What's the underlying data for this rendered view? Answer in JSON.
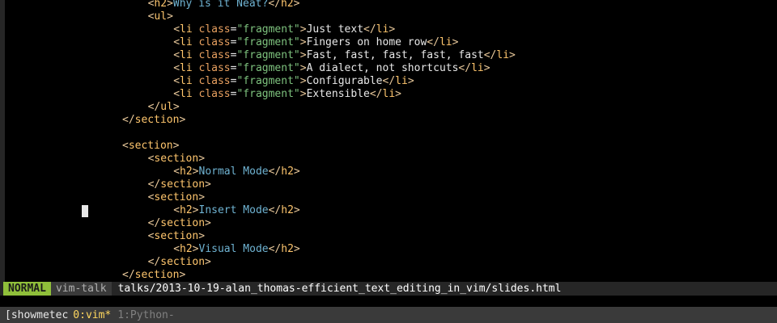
{
  "editor": {
    "lines": [
      {
        "indent": 24,
        "segments": [
          {
            "t": "<",
            "c": "bracket"
          },
          {
            "t": "h2",
            "c": "tag"
          },
          {
            "t": ">",
            "c": "bracket"
          },
          {
            "t": "Why is it Neat?",
            "c": "h2txt"
          },
          {
            "t": "</",
            "c": "bracket"
          },
          {
            "t": "h2",
            "c": "tag"
          },
          {
            "t": ">",
            "c": "bracket"
          }
        ]
      },
      {
        "indent": 24,
        "segments": [
          {
            "t": "<",
            "c": "bracket"
          },
          {
            "t": "ul",
            "c": "tag"
          },
          {
            "t": ">",
            "c": "bracket"
          }
        ]
      },
      {
        "indent": 28,
        "segments": [
          {
            "t": "<",
            "c": "bracket"
          },
          {
            "t": "li",
            "c": "tag"
          },
          {
            "t": " class",
            "c": "attr"
          },
          {
            "t": "=",
            "c": "txt"
          },
          {
            "t": "\"fragment\"",
            "c": "str"
          },
          {
            "t": ">",
            "c": "bracket"
          },
          {
            "t": "Just text",
            "c": "txt"
          },
          {
            "t": "</",
            "c": "bracket"
          },
          {
            "t": "li",
            "c": "tag"
          },
          {
            "t": ">",
            "c": "bracket"
          }
        ]
      },
      {
        "indent": 28,
        "segments": [
          {
            "t": "<",
            "c": "bracket"
          },
          {
            "t": "li",
            "c": "tag"
          },
          {
            "t": " class",
            "c": "attr"
          },
          {
            "t": "=",
            "c": "txt"
          },
          {
            "t": "\"fragment\"",
            "c": "str"
          },
          {
            "t": ">",
            "c": "bracket"
          },
          {
            "t": "Fingers on home row",
            "c": "txt"
          },
          {
            "t": "</",
            "c": "bracket"
          },
          {
            "t": "li",
            "c": "tag"
          },
          {
            "t": ">",
            "c": "bracket"
          }
        ]
      },
      {
        "indent": 28,
        "segments": [
          {
            "t": "<",
            "c": "bracket"
          },
          {
            "t": "li",
            "c": "tag"
          },
          {
            "t": " class",
            "c": "attr"
          },
          {
            "t": "=",
            "c": "txt"
          },
          {
            "t": "\"fragment\"",
            "c": "str"
          },
          {
            "t": ">",
            "c": "bracket"
          },
          {
            "t": "Fast, fast, fast, fast, fast",
            "c": "txt"
          },
          {
            "t": "</",
            "c": "bracket"
          },
          {
            "t": "li",
            "c": "tag"
          },
          {
            "t": ">",
            "c": "bracket"
          }
        ]
      },
      {
        "indent": 28,
        "segments": [
          {
            "t": "<",
            "c": "bracket"
          },
          {
            "t": "li",
            "c": "tag"
          },
          {
            "t": " class",
            "c": "attr"
          },
          {
            "t": "=",
            "c": "txt"
          },
          {
            "t": "\"fragment\"",
            "c": "str"
          },
          {
            "t": ">",
            "c": "bracket"
          },
          {
            "t": "A dialect, not shortcuts",
            "c": "txt"
          },
          {
            "t": "</",
            "c": "bracket"
          },
          {
            "t": "li",
            "c": "tag"
          },
          {
            "t": ">",
            "c": "bracket"
          }
        ]
      },
      {
        "indent": 28,
        "segments": [
          {
            "t": "<",
            "c": "bracket"
          },
          {
            "t": "li",
            "c": "tag"
          },
          {
            "t": " class",
            "c": "attr"
          },
          {
            "t": "=",
            "c": "txt"
          },
          {
            "t": "\"fragment\"",
            "c": "str"
          },
          {
            "t": ">",
            "c": "bracket"
          },
          {
            "t": "Configurable",
            "c": "txt"
          },
          {
            "t": "</",
            "c": "bracket"
          },
          {
            "t": "li",
            "c": "tag"
          },
          {
            "t": ">",
            "c": "bracket"
          }
        ]
      },
      {
        "indent": 28,
        "segments": [
          {
            "t": "<",
            "c": "bracket"
          },
          {
            "t": "li",
            "c": "tag"
          },
          {
            "t": " class",
            "c": "attr"
          },
          {
            "t": "=",
            "c": "txt"
          },
          {
            "t": "\"fragment\"",
            "c": "str"
          },
          {
            "t": ">",
            "c": "bracket"
          },
          {
            "t": "Extensible",
            "c": "txt"
          },
          {
            "t": "</",
            "c": "bracket"
          },
          {
            "t": "li",
            "c": "tag"
          },
          {
            "t": ">",
            "c": "bracket"
          }
        ]
      },
      {
        "indent": 24,
        "segments": [
          {
            "t": "</",
            "c": "bracket"
          },
          {
            "t": "ul",
            "c": "tag"
          },
          {
            "t": ">",
            "c": "bracket"
          }
        ]
      },
      {
        "indent": 20,
        "segments": [
          {
            "t": "</",
            "c": "bracket"
          },
          {
            "t": "section",
            "c": "tag"
          },
          {
            "t": ">",
            "c": "bracket"
          }
        ]
      },
      {
        "indent": 0,
        "segments": []
      },
      {
        "indent": 20,
        "segments": [
          {
            "t": "<",
            "c": "bracket"
          },
          {
            "t": "section",
            "c": "tag"
          },
          {
            "t": ">",
            "c": "bracket"
          }
        ]
      },
      {
        "indent": 24,
        "segments": [
          {
            "t": "<",
            "c": "bracket"
          },
          {
            "t": "section",
            "c": "tag"
          },
          {
            "t": ">",
            "c": "bracket"
          }
        ]
      },
      {
        "indent": 28,
        "segments": [
          {
            "t": "<",
            "c": "bracket"
          },
          {
            "t": "h2",
            "c": "tag"
          },
          {
            "t": ">",
            "c": "bracket"
          },
          {
            "t": "Normal Mode",
            "c": "h2txt"
          },
          {
            "t": "</",
            "c": "bracket"
          },
          {
            "t": "h2",
            "c": "tag"
          },
          {
            "t": ">",
            "c": "bracket"
          }
        ]
      },
      {
        "indent": 24,
        "segments": [
          {
            "t": "</",
            "c": "bracket"
          },
          {
            "t": "section",
            "c": "tag"
          },
          {
            "t": ">",
            "c": "bracket"
          }
        ]
      },
      {
        "indent": 24,
        "segments": [
          {
            "t": "<",
            "c": "bracket"
          },
          {
            "t": "section",
            "c": "tag"
          },
          {
            "t": ">",
            "c": "bracket"
          }
        ]
      },
      {
        "indent": 28,
        "cursor": true,
        "segments": [
          {
            "t": "<",
            "c": "bracket"
          },
          {
            "t": "h2",
            "c": "tag"
          },
          {
            "t": ">",
            "c": "bracket"
          },
          {
            "t": "Insert Mode",
            "c": "h2txt"
          },
          {
            "t": "</",
            "c": "bracket"
          },
          {
            "t": "h2",
            "c": "tag"
          },
          {
            "t": ">",
            "c": "bracket"
          }
        ]
      },
      {
        "indent": 24,
        "segments": [
          {
            "t": "</",
            "c": "bracket"
          },
          {
            "t": "section",
            "c": "tag"
          },
          {
            "t": ">",
            "c": "bracket"
          }
        ]
      },
      {
        "indent": 24,
        "segments": [
          {
            "t": "<",
            "c": "bracket"
          },
          {
            "t": "section",
            "c": "tag"
          },
          {
            "t": ">",
            "c": "bracket"
          }
        ]
      },
      {
        "indent": 28,
        "segments": [
          {
            "t": "<",
            "c": "bracket"
          },
          {
            "t": "h2",
            "c": "tag"
          },
          {
            "t": ">",
            "c": "bracket"
          },
          {
            "t": "Visual Mode",
            "c": "h2txt"
          },
          {
            "t": "</",
            "c": "bracket"
          },
          {
            "t": "h2",
            "c": "tag"
          },
          {
            "t": ">",
            "c": "bracket"
          }
        ]
      },
      {
        "indent": 24,
        "segments": [
          {
            "t": "</",
            "c": "bracket"
          },
          {
            "t": "section",
            "c": "tag"
          },
          {
            "t": ">",
            "c": "bracket"
          }
        ]
      },
      {
        "indent": 20,
        "segments": [
          {
            "t": "</",
            "c": "bracket"
          },
          {
            "t": "section",
            "c": "tag"
          },
          {
            "t": ">",
            "c": "bracket"
          }
        ]
      }
    ]
  },
  "statusline": {
    "mode": "NORMAL",
    "branch": "vim-talk",
    "filepath": "talks/2013-10-19-alan_thomas-efficient_text_editing_in_vim/slides.html"
  },
  "tmux": {
    "session": "[showmetec",
    "active_window_index": "0:",
    "active_window_name": "vim*",
    "inactive_window": "1:Python-"
  },
  "colors": {
    "mode_bg": "#8fbf3a",
    "tag": "#ffc66d",
    "string": "#7ec27e",
    "heading_text": "#6fb3d2"
  }
}
